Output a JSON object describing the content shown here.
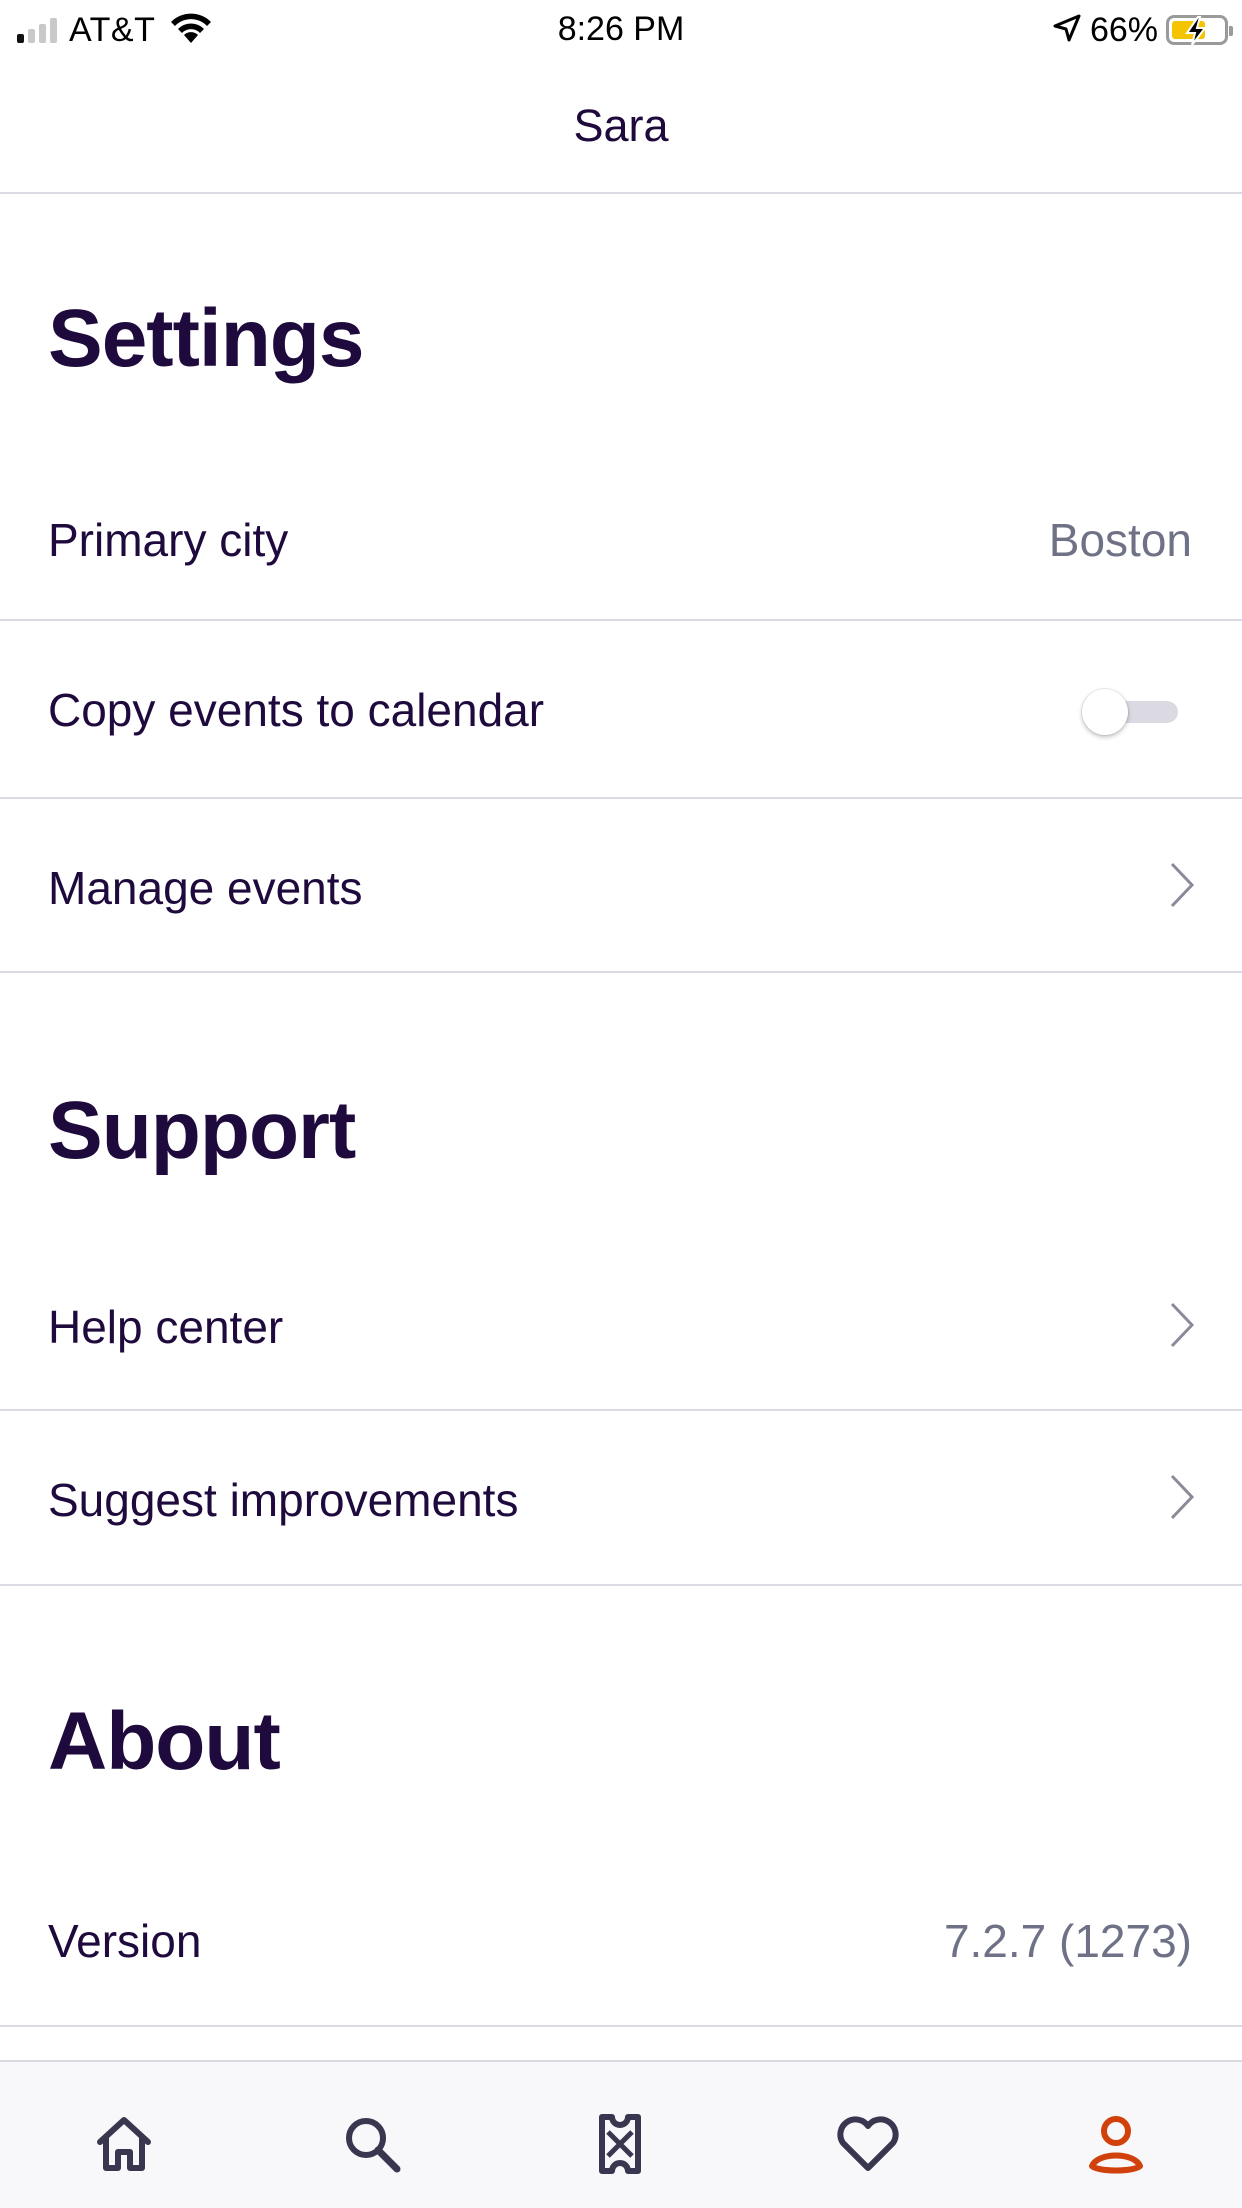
{
  "status_bar": {
    "carrier": "AT&T",
    "time": "8:26 PM",
    "battery_percent": "66%",
    "signal_bars": 1,
    "battery_level": 0.66,
    "battery_color": "#f5c400"
  },
  "header": {
    "title": "Sara"
  },
  "sections": {
    "settings": {
      "title": "Settings",
      "primary_city": {
        "label": "Primary city",
        "value": "Boston"
      },
      "copy_events": {
        "label": "Copy events to calendar",
        "toggle_on": false
      },
      "manage_events": {
        "label": "Manage events",
        "icon": "chevron-right-icon"
      }
    },
    "support": {
      "title": "Support",
      "help_center": {
        "label": "Help center",
        "icon": "chevron-right-icon"
      },
      "suggest": {
        "label": "Suggest improvements",
        "icon": "chevron-right-icon"
      }
    },
    "about": {
      "title": "About",
      "version": {
        "label": "Version",
        "value": "7.2.7 (1273)"
      }
    }
  },
  "tab_bar": {
    "tabs": [
      {
        "icon": "home-icon",
        "active": false
      },
      {
        "icon": "search-icon",
        "active": false
      },
      {
        "icon": "ticket-icon",
        "active": false
      },
      {
        "icon": "heart-icon",
        "active": false
      },
      {
        "icon": "profile-icon",
        "active": true
      }
    ],
    "inactive_color": "#39364f",
    "active_color": "#d1410c"
  },
  "colors": {
    "text_primary": "#1e0a3c",
    "text_secondary": "#6f7287",
    "divider": "#dbdae3"
  }
}
